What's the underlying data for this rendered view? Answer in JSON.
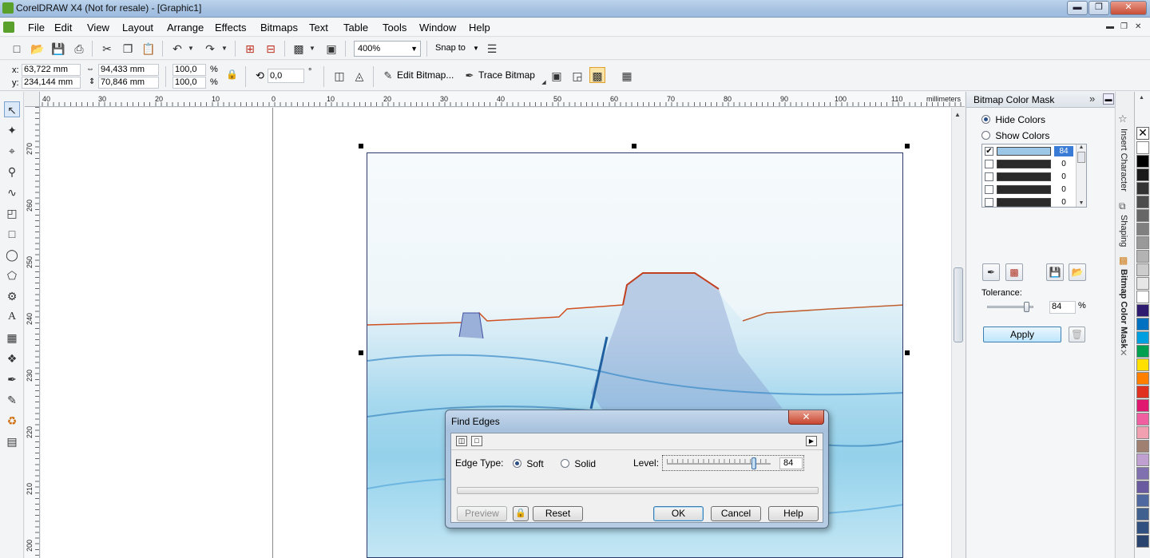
{
  "window": {
    "title": "CorelDRAW X4 (Not for resale) - [Graphic1]"
  },
  "menu": [
    "File",
    "Edit",
    "View",
    "Layout",
    "Arrange",
    "Effects",
    "Bitmaps",
    "Text",
    "Table",
    "Tools",
    "Window",
    "Help"
  ],
  "standard_toolbar": {
    "zoom": "400%",
    "snap_to": "Snap to"
  },
  "property_bar": {
    "x_label": "x:",
    "x": "63,722 mm",
    "y_label": "y:",
    "y": "234,144 mm",
    "width": "94,433 mm",
    "height": "70,846 mm",
    "scale_x": "100,0",
    "scale_y": "100,0",
    "percent": "%",
    "rotation": "0,0",
    "degree": "°",
    "edit_bitmap": "Edit Bitmap...",
    "trace_bitmap": "Trace Bitmap"
  },
  "ruler": {
    "h_ticks": [
      "40",
      "30",
      "20",
      "10",
      "0",
      "10",
      "20",
      "30",
      "40",
      "50",
      "60",
      "70",
      "80",
      "90",
      "100",
      "110"
    ],
    "units": "millimeters",
    "v_ticks": [
      "270",
      "260",
      "250",
      "240",
      "230",
      "220",
      "210",
      "200"
    ]
  },
  "docker": {
    "title": "Bitmap Color Mask",
    "hide_colors": "Hide Colors",
    "show_colors": "Show Colors",
    "color_rows": [
      {
        "checked": true,
        "value": "84"
      },
      {
        "checked": false,
        "value": "0"
      },
      {
        "checked": false,
        "value": "0"
      },
      {
        "checked": false,
        "value": "0"
      },
      {
        "checked": false,
        "value": "0"
      }
    ],
    "tolerance_label": "Tolerance:",
    "tolerance": "84",
    "percent": "%",
    "tolerance_level": 0.84,
    "apply": "Apply"
  },
  "side_tabs": [
    "Insert Character",
    "Shaping",
    "Bitmap Color Mask"
  ],
  "palette": [
    "#ffffff",
    "#000000",
    "#1a1a1a",
    "#333333",
    "#4d4d4d",
    "#666666",
    "#808080",
    "#999999",
    "#b3b3b3",
    "#cccccc",
    "#e6e6e6",
    "#ffffff",
    "#2e1a6e",
    "#0070c0",
    "#00a0e0",
    "#00a050",
    "#ffe000",
    "#ff8000",
    "#e03020",
    "#e01870",
    "#f060a0",
    "#f0a0b0",
    "#a08070",
    "#c0a0d0",
    "#8070b0",
    "#6a5aa0",
    "#5068a0",
    "#406090",
    "#305080",
    "#2a4470"
  ],
  "dialog": {
    "title": "Find Edges",
    "edge_type_label": "Edge Type:",
    "soft": "Soft",
    "solid": "Solid",
    "level_label": "Level:",
    "level": "84",
    "level_fraction": 0.84,
    "preview": "Preview",
    "reset": "Reset",
    "ok": "OK",
    "cancel": "Cancel",
    "help": "Help"
  }
}
